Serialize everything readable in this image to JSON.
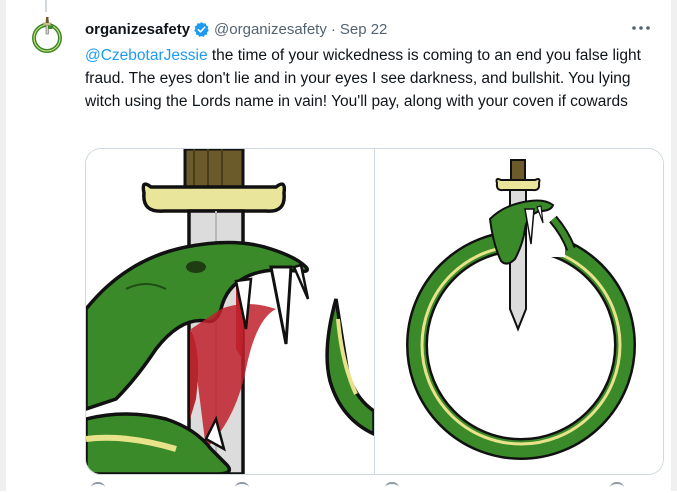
{
  "tweet": {
    "display_name": "organizesafety",
    "handle": "@organizesafety",
    "separator": "·",
    "date": "Sep 22",
    "mention": "@CzebotarJessie",
    "text": " the time of your wickedness is coming to an end you false light fraud. The eyes don't lie and in your eyes I see darkness, and bullshit. You lying witch using the Lords name in vain! You'll pay, along with your coven if cowards"
  },
  "icons": {
    "verified": "verified-badge-icon",
    "more": "more-options-icon",
    "avatar": "snake-dagger-avatar"
  },
  "colors": {
    "link": "#1d9bf0",
    "verified": "#1d9bf0",
    "snake_green": "#3a8a2a",
    "snake_dark": "#2d6b1f",
    "belly_yellow": "#e8e38a",
    "hilt_yellow": "#e9e59a",
    "handle_brown": "#6b5a2a",
    "blade_gray": "#d9d9d9"
  }
}
